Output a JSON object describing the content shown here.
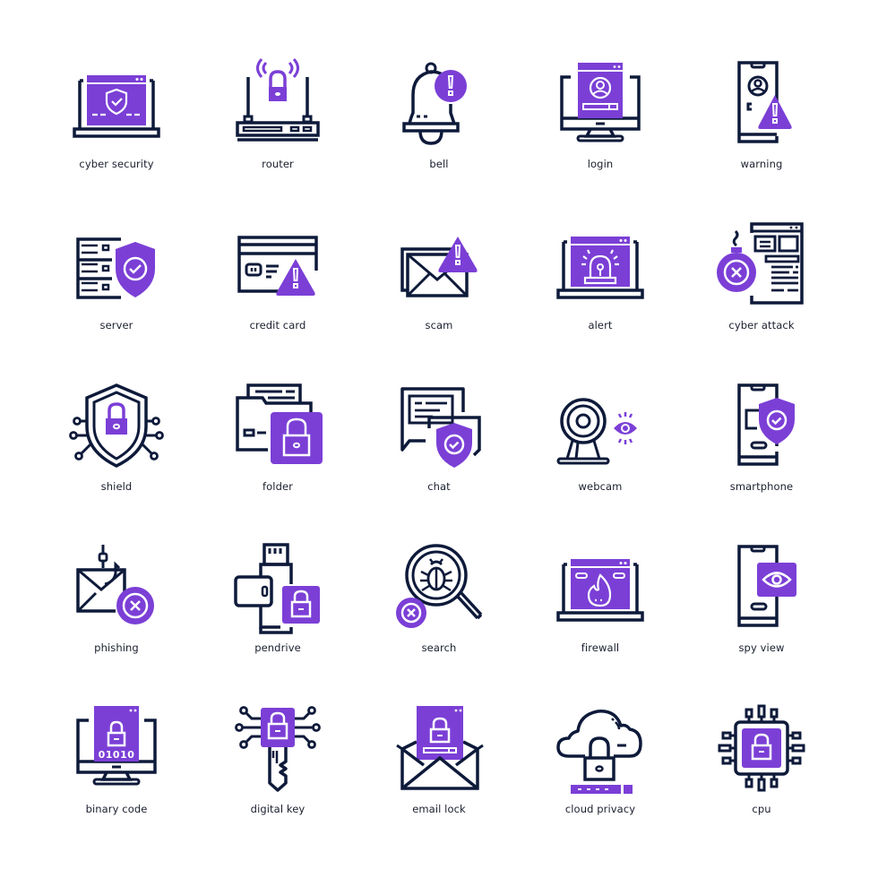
{
  "colors": {
    "accent": "#7B3FD6",
    "stroke": "#0E1A3A",
    "background": "#FFFFFF"
  },
  "icons": [
    {
      "label": "cyber security",
      "icon": "cyber-security-icon"
    },
    {
      "label": "router",
      "icon": "router-icon"
    },
    {
      "label": "bell",
      "icon": "bell-icon"
    },
    {
      "label": "login",
      "icon": "login-icon"
    },
    {
      "label": "warning",
      "icon": "warning-icon"
    },
    {
      "label": "server",
      "icon": "server-icon"
    },
    {
      "label": "credit card",
      "icon": "credit-card-icon"
    },
    {
      "label": "scam",
      "icon": "scam-icon"
    },
    {
      "label": "alert",
      "icon": "alert-icon"
    },
    {
      "label": "cyber attack",
      "icon": "cyber-attack-icon"
    },
    {
      "label": "shield",
      "icon": "shield-icon"
    },
    {
      "label": "folder",
      "icon": "folder-icon"
    },
    {
      "label": "chat",
      "icon": "chat-icon"
    },
    {
      "label": "webcam",
      "icon": "webcam-icon"
    },
    {
      "label": "smartphone",
      "icon": "smartphone-icon"
    },
    {
      "label": "phishing",
      "icon": "phishing-icon"
    },
    {
      "label": "pendrive",
      "icon": "pendrive-icon"
    },
    {
      "label": "search",
      "icon": "search-icon"
    },
    {
      "label": "firewall",
      "icon": "firewall-icon"
    },
    {
      "label": "spy view",
      "icon": "spy-view-icon"
    },
    {
      "label": "binary code",
      "icon": "binary-code-icon",
      "text": "01010"
    },
    {
      "label": "digital key",
      "icon": "digital-key-icon"
    },
    {
      "label": "email lock",
      "icon": "email-lock-icon"
    },
    {
      "label": "cloud privacy",
      "icon": "cloud-privacy-icon"
    },
    {
      "label": "cpu",
      "icon": "cpu-icon"
    }
  ]
}
